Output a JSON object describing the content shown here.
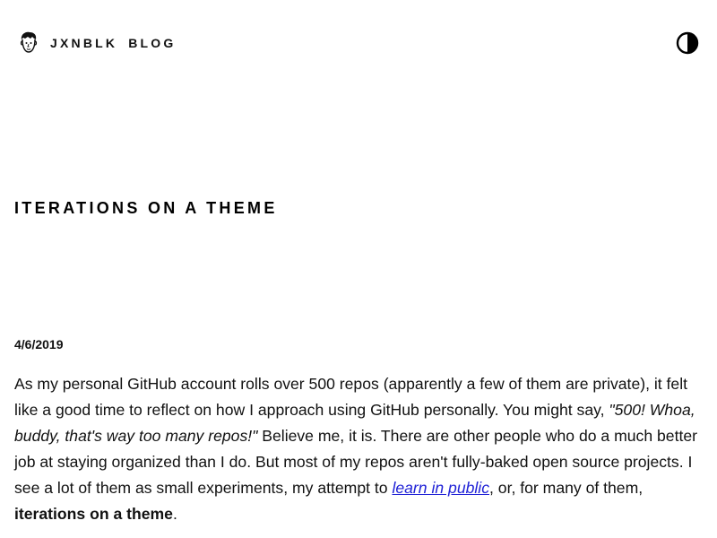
{
  "header": {
    "site_name": "JXNBLK",
    "blog_label": "BLOG",
    "avatar_icon": "cartoon-face-avatar",
    "theme_toggle_icon": "half-circle-contrast-icon"
  },
  "post": {
    "title": "ITERATIONS ON A THEME",
    "date": "4/6/2019",
    "body": {
      "part1": "As my personal GitHub account rolls over 500 repos (apparently a few of them are private), it felt like a good time to reflect on how I approach using GitHub personally. You might say, ",
      "quote": "\"500! Whoa, buddy, that's way too many repos!\"",
      "part2": " Believe me, it is. There are other people who do a much better job at staying organized than I do. But most of my repos aren't fully-baked open source projects. I see a lot of them as small experiments, my attempt to ",
      "link_text": "learn in public",
      "part3": ", or, for many of them, ",
      "bold_text": "iterations on a theme",
      "part4": "."
    }
  },
  "colors": {
    "text": "#111111",
    "link": "#1f21d6",
    "background": "#ffffff"
  }
}
